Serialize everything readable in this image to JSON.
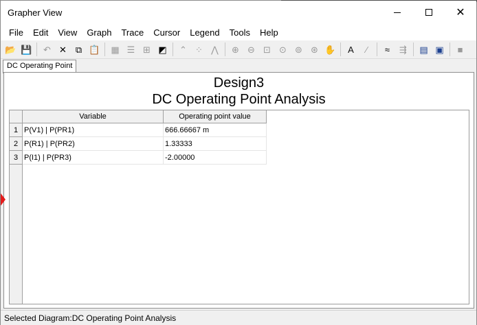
{
  "window": {
    "title": "Grapher View"
  },
  "menu": [
    "File",
    "Edit",
    "View",
    "Graph",
    "Trace",
    "Cursor",
    "Legend",
    "Tools",
    "Help"
  ],
  "toolbar": [
    {
      "name": "open-icon",
      "glyph": "📂"
    },
    {
      "name": "save-icon",
      "glyph": "💾"
    },
    {
      "sep": true
    },
    {
      "name": "undo-icon",
      "glyph": "↶",
      "disabled": true
    },
    {
      "name": "cut-icon",
      "glyph": "✕"
    },
    {
      "name": "copy-icon",
      "glyph": "⧉"
    },
    {
      "name": "paste-icon",
      "glyph": "📋"
    },
    {
      "sep": true
    },
    {
      "name": "grid-icon",
      "glyph": "▦",
      "disabled": true
    },
    {
      "name": "list-icon",
      "glyph": "☰",
      "disabled": true
    },
    {
      "name": "axis-icon",
      "glyph": "⊞",
      "disabled": true
    },
    {
      "name": "overlay-icon",
      "glyph": "◩"
    },
    {
      "sep": true
    },
    {
      "name": "line-chart-icon",
      "glyph": "⌃",
      "disabled": true
    },
    {
      "name": "scatter-icon",
      "glyph": "⁘",
      "disabled": true
    },
    {
      "name": "line-points-icon",
      "glyph": "⋀",
      "disabled": true
    },
    {
      "sep": true
    },
    {
      "name": "zoom-in-icon",
      "glyph": "⊕",
      "disabled": true
    },
    {
      "name": "zoom-out-icon",
      "glyph": "⊖",
      "disabled": true
    },
    {
      "name": "zoom-fit-icon",
      "glyph": "⊡",
      "disabled": true
    },
    {
      "name": "zoom-x-icon",
      "glyph": "⊙",
      "disabled": true
    },
    {
      "name": "zoom-y-icon",
      "glyph": "⊚",
      "disabled": true
    },
    {
      "name": "zoom-area-icon",
      "glyph": "⊛",
      "disabled": true
    },
    {
      "name": "pan-icon",
      "glyph": "✋",
      "disabled": true
    },
    {
      "sep": true
    },
    {
      "name": "text-icon",
      "glyph": "A",
      "dark": true
    },
    {
      "name": "marker-icon",
      "glyph": "⁄",
      "disabled": true
    },
    {
      "sep": true
    },
    {
      "name": "trace-icon",
      "glyph": "≈"
    },
    {
      "name": "export-icon",
      "glyph": "⇶",
      "disabled": true
    },
    {
      "sep": true
    },
    {
      "name": "properties-icon",
      "glyph": "▤",
      "blue": true
    },
    {
      "name": "print-preview-icon",
      "glyph": "▣",
      "blue": true
    },
    {
      "sep": true
    },
    {
      "name": "stop-icon",
      "glyph": "■",
      "disabled": true
    }
  ],
  "tab": {
    "label": "DC Operating Point"
  },
  "diagram": {
    "title": "Design3",
    "subtitle": "DC Operating Point Analysis"
  },
  "table": {
    "columns": [
      "Variable",
      "Operating point value"
    ],
    "rows": [
      {
        "num": "1",
        "variable": "P(V1) | P(PR1)",
        "value": "666.66667 m"
      },
      {
        "num": "2",
        "variable": "P(R1) | P(PR2)",
        "value": "1.33333"
      },
      {
        "num": "3",
        "variable": "P(I1) | P(PR3)",
        "value": "-2.00000"
      }
    ]
  },
  "status": "Selected Diagram:DC Operating Point Analysis",
  "colors": {
    "marker": "#e41b1b",
    "background": "#f0f0f0"
  }
}
